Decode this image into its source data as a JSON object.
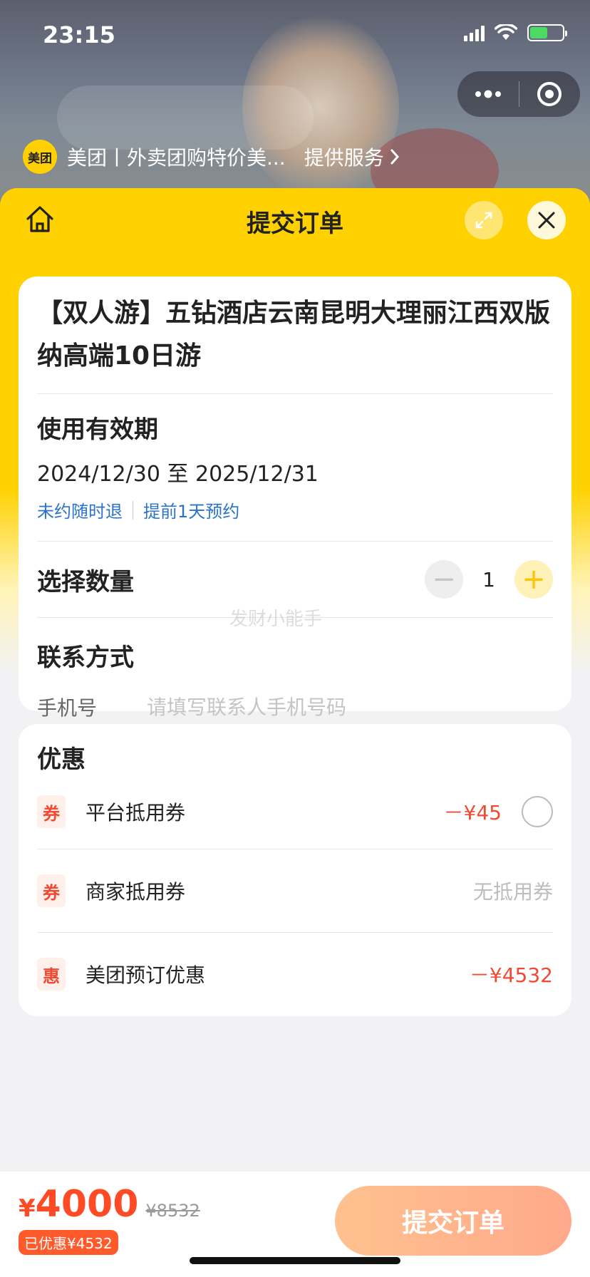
{
  "status_bar": {
    "time": "23:15"
  },
  "mini_program": {
    "logo_text": "美团",
    "title": "美团丨外卖团购特价美...",
    "provide_service": "提供服务",
    "more_icon": "more-dots-icon",
    "close_icon": "target-icon"
  },
  "sheet": {
    "title": "提交订单",
    "home_icon": "home-icon",
    "expand_icon": "expand-icon",
    "close_icon": "close-icon"
  },
  "product": {
    "title": "【双人游】五钻酒店云南昆明大理丽江西双版纳高端10日游"
  },
  "validity": {
    "heading": "使用有效期",
    "date_range": "2024/12/30 至 2025/12/31",
    "tag1": "未约随时退",
    "tag2": "提前1天预约"
  },
  "quantity": {
    "heading": "选择数量",
    "minus": "−",
    "value": "1",
    "plus": "+"
  },
  "watermark": "发财小能手",
  "contact": {
    "heading": "联系方式",
    "phone_label": "手机号",
    "phone_placeholder": "请填写联系人手机号码",
    "phone_value": ""
  },
  "promotions": {
    "heading": "优惠",
    "items": [
      {
        "badge": "券",
        "label": "平台抵用券",
        "value": "－¥45"
      },
      {
        "badge": "券",
        "label": "商家抵用券",
        "value": "无抵用券"
      },
      {
        "badge": "惠",
        "label": "美团预订优惠",
        "value": "－¥4532"
      }
    ]
  },
  "bottom_bar": {
    "currency": "¥",
    "price": "4000",
    "original_price": "¥8532",
    "saved": "已优惠¥4532",
    "submit_label": "提交订单"
  },
  "colors": {
    "brand_yellow": "#ffd100",
    "accent_red": "#f04a32",
    "link_blue": "#2a73c9",
    "submit_gradient_start": "#ffc18f",
    "submit_gradient_end": "#ffa98a"
  }
}
